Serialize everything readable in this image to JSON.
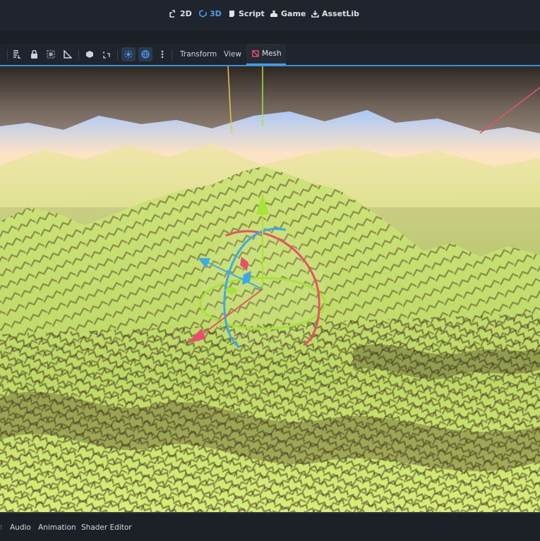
{
  "workspace_tabs": [
    {
      "label": "2D",
      "icon": "2d-workspace-icon"
    },
    {
      "label": "3D",
      "icon": "3d-workspace-icon"
    },
    {
      "label": "Script",
      "icon": "script-icon"
    },
    {
      "label": "Game",
      "icon": "game-icon"
    },
    {
      "label": "AssetLib",
      "icon": "assetlib-icon"
    }
  ],
  "active_workspace": "3D",
  "accent_color": "#4d9cf0",
  "viewport_menus": {
    "transform": "Transform",
    "view": "View",
    "mesh": "Mesh"
  },
  "toolbar_icons": [
    "list-select-icon",
    "lock-icon",
    "group-icon",
    "ruler-icon",
    "snap-icon",
    "local-space-icon",
    "sun-icon",
    "environment-icon",
    "more-icon"
  ],
  "bottom_panels": [
    "Audio",
    "Animation",
    "Shader Editor"
  ],
  "gizmo_colors": {
    "x": "#e8506a",
    "y": "#a6e23a",
    "z": "#3fa9e6"
  }
}
